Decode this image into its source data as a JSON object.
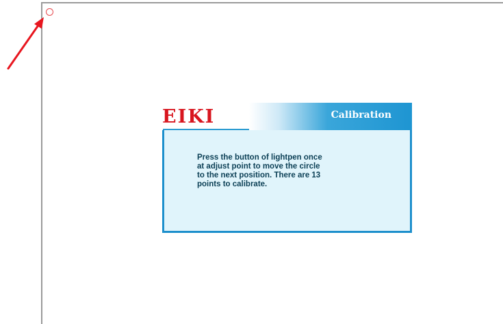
{
  "dialog": {
    "logo": "EIKI",
    "title": "Calibration",
    "message": "Press the button of lightpen once\nat adjust point to move  the  circle\nto the next position. There  are  13\npoints to calibrate."
  },
  "colors": {
    "logo_red": "#d8161f",
    "title_blue": "#1e95d2",
    "panel_bg": "#e0f4fb",
    "arrow_red": "#e8161f"
  },
  "icons": {
    "calibration_target": "circle-outline",
    "pointer": "red-arrow"
  }
}
